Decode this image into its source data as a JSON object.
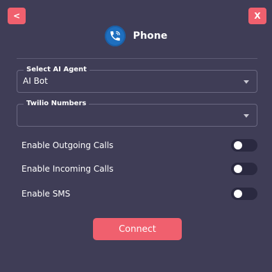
{
  "window": {
    "back_label": "<",
    "close_label": "X"
  },
  "header": {
    "title": "Phone",
    "icon": "phone-icon"
  },
  "fields": {
    "agent": {
      "label": "Select AI Agent",
      "value": "AI Bot"
    },
    "twilio": {
      "label": "Twilio Numbers",
      "value": ""
    }
  },
  "toggles": {
    "outgoing": {
      "label": "Enable Outgoing Calls",
      "enabled": false
    },
    "incoming": {
      "label": "Enable Incoming Calls",
      "enabled": false
    },
    "sms": {
      "label": "Enable SMS",
      "enabled": false
    }
  },
  "actions": {
    "connect_label": "Connect"
  },
  "colors": {
    "background": "#3f3d56",
    "accent": "#f0606e",
    "phone_icon": "#1e6fbf",
    "toggle_off": "#2a2940"
  }
}
